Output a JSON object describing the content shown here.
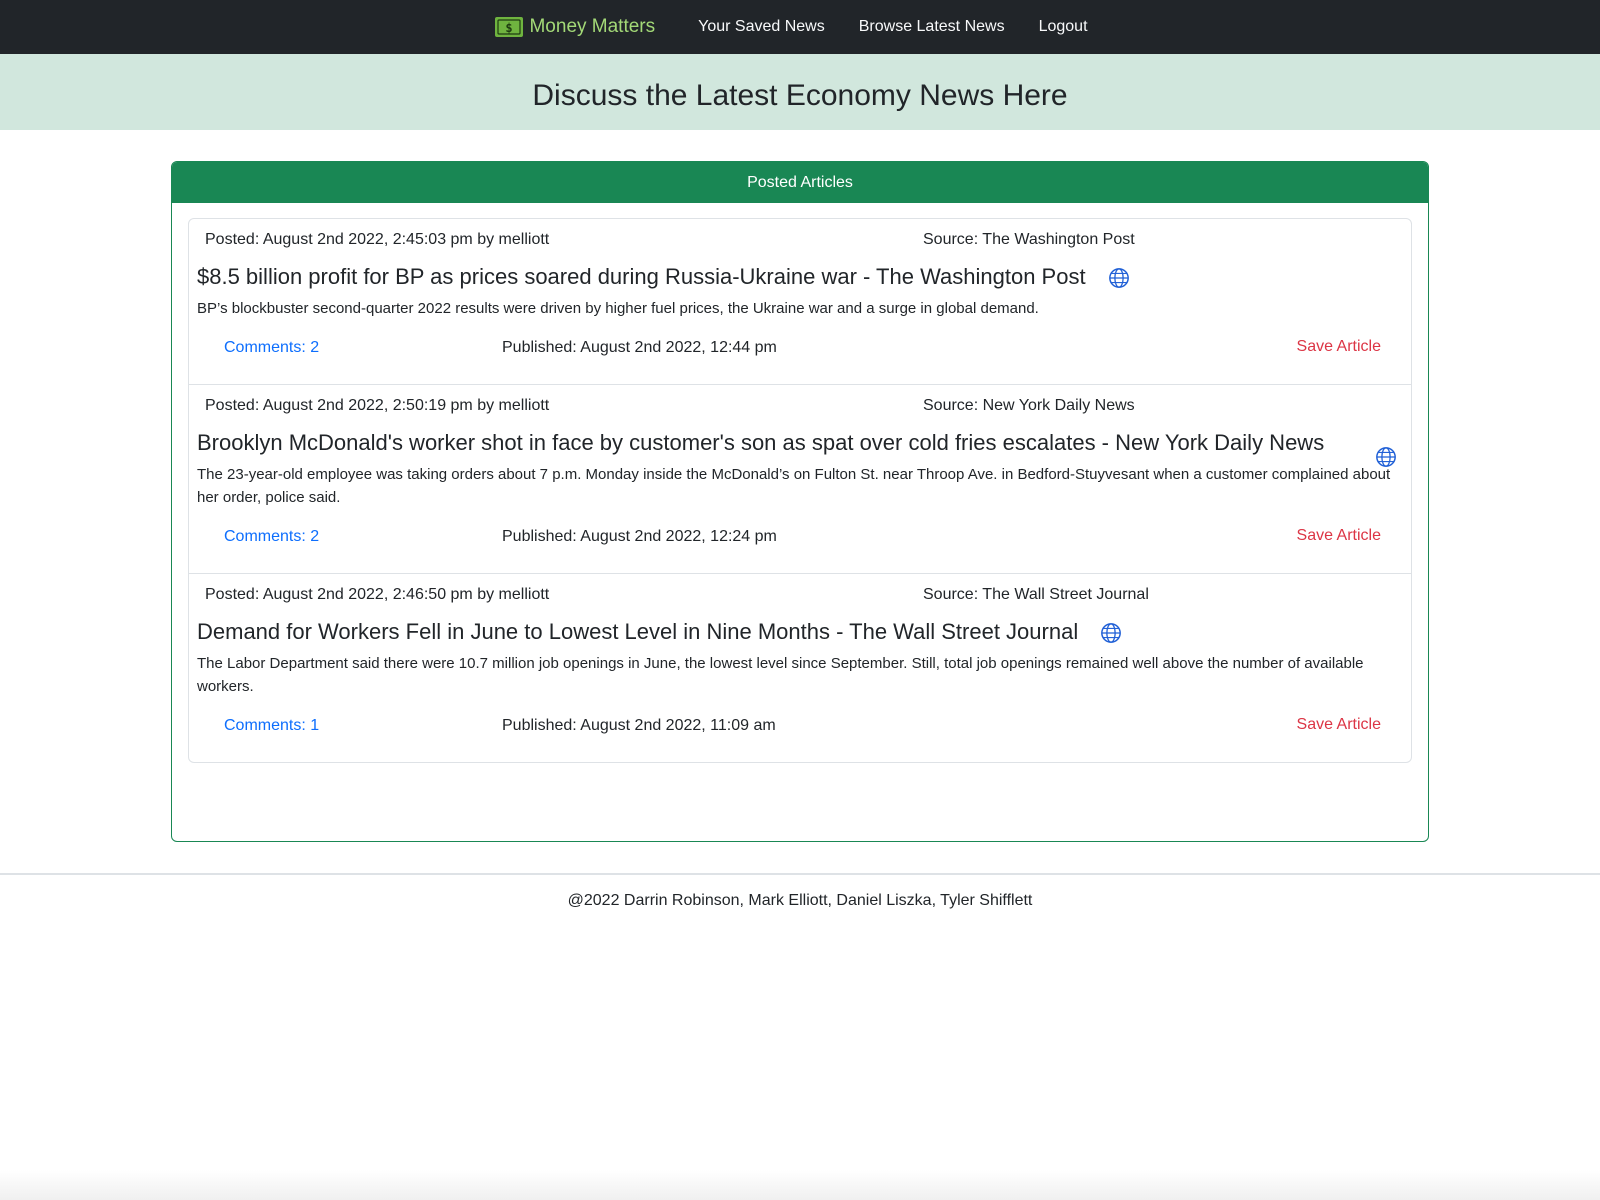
{
  "navbar": {
    "brand": "Money Matters",
    "brand_icon": "money-bill-icon",
    "brand_color": "#a3d977",
    "links": [
      "Your Saved News",
      "Browse Latest News",
      "Logout"
    ]
  },
  "hero": {
    "title": "Discuss the Latest Economy News Here"
  },
  "card": {
    "header": "Posted Articles",
    "accent": "#198754"
  },
  "articles": [
    {
      "posted": "Posted: August 2nd 2022, 2:45:03 pm by melliott",
      "source": "Source: The Washington Post",
      "title": "$8.5 billion profit for BP as prices soared during Russia-Ukraine war - The Washington Post",
      "description": "BP’s blockbuster second-quarter 2022 results were driven by higher fuel prices, the Ukraine war and a surge in global demand.",
      "comments": "Comments: 2",
      "published": "Published: August 2nd 2022, 12:44 pm",
      "save": "Save Article"
    },
    {
      "posted": "Posted: August 2nd 2022, 2:50:19 pm by melliott",
      "source": "Source: New York Daily News",
      "title": "Brooklyn McDonald's worker shot in face by customer's son as spat over cold fries escalates - New York Daily News",
      "description": "The 23-year-old employee was taking orders about 7 p.m. Monday inside the McDonald’s on Fulton St. near Throop Ave. in Bedford-Stuyvesant when a customer complained about her order, police said.",
      "comments": "Comments: 2",
      "published": "Published: August 2nd 2022, 12:24 pm",
      "save": "Save Article"
    },
    {
      "posted": "Posted: August 2nd 2022, 2:46:50 pm by melliott",
      "source": "Source: The Wall Street Journal",
      "title": "Demand for Workers Fell in June to Lowest Level in Nine Months - The Wall Street Journal",
      "description": "The Labor Department said there were 10.7 million job openings in June, the lowest level since September. Still, total job openings remained well above the number of available workers.",
      "comments": "Comments: 1",
      "published": "Published: August 2nd 2022, 11:09 am",
      "save": "Save Article"
    }
  ],
  "footer": {
    "text": "@2022 Darrin Robinson, Mark Elliott, Daniel Liszka, Tyler Shifflett"
  }
}
